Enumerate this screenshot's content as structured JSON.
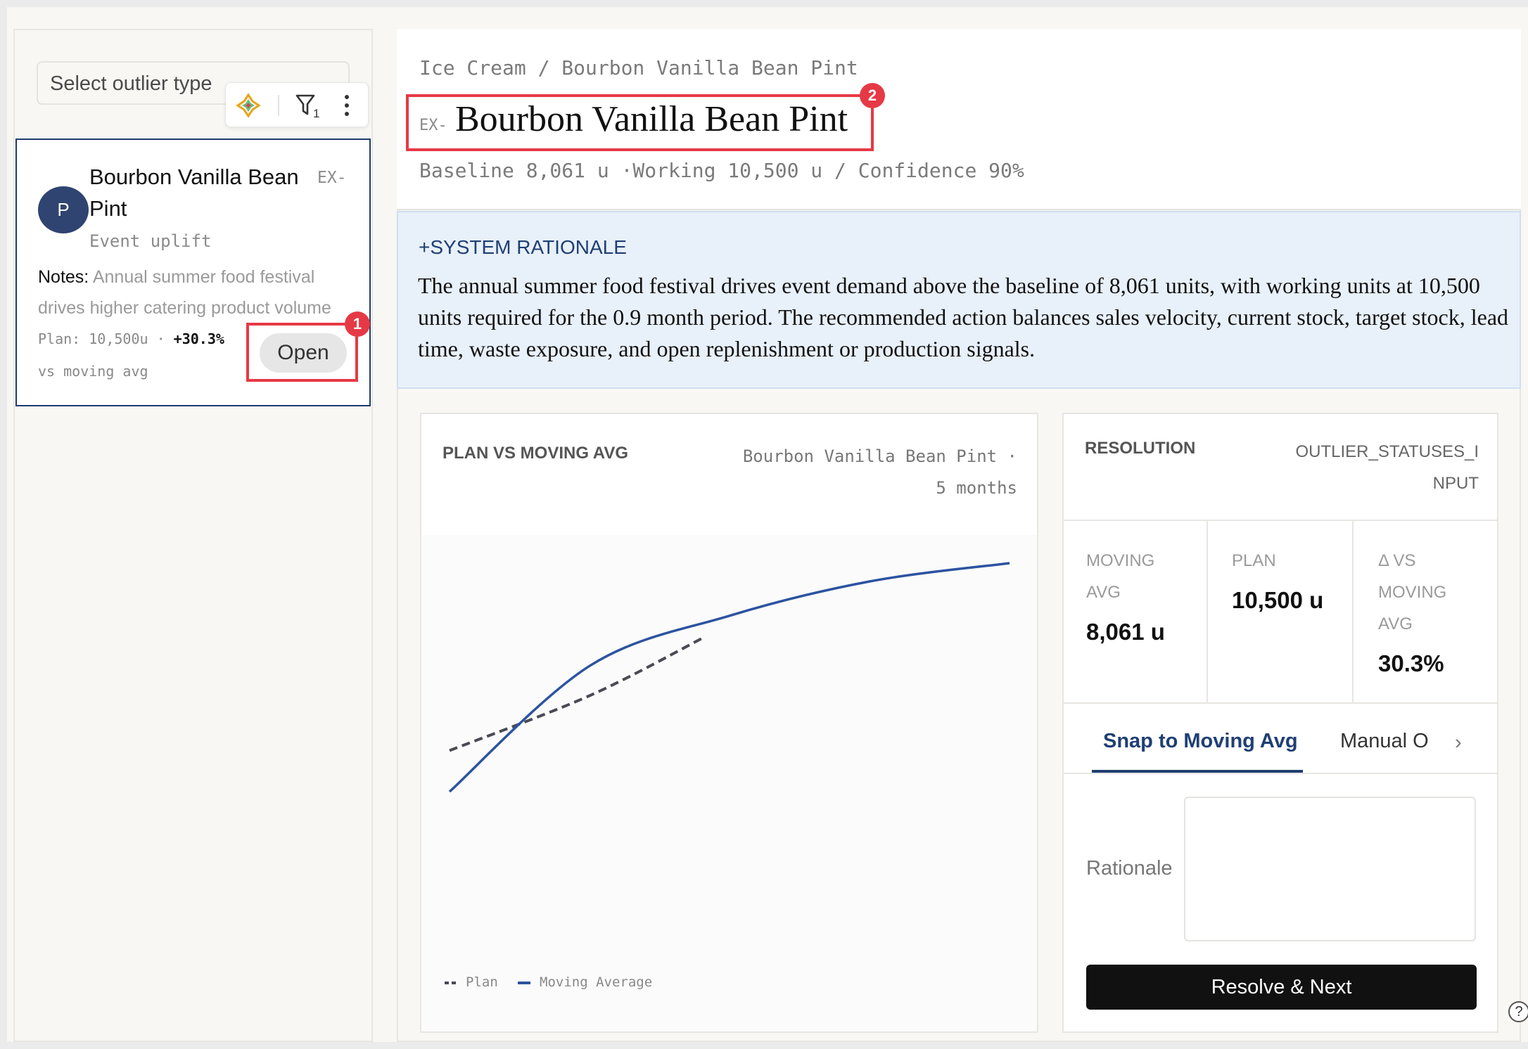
{
  "sidebar": {
    "select_placeholder": "Select outlier type",
    "filter_count": "1",
    "card": {
      "avatar": "P",
      "title": "Bourbon Vanilla Bean Pint",
      "id_prefix": "EX-",
      "subtitle": "Event uplift",
      "notes_label": "Notes:",
      "notes_text": "Annual summer food festival drives higher catering product volume",
      "plan_text": "Plan: 10,500u ·",
      "plan_delta": "+30.3%",
      "vs_text": "vs moving avg",
      "open_label": "Open"
    }
  },
  "annotations": {
    "badge_1": "1",
    "badge_2": "2"
  },
  "header": {
    "breadcrumb": "Ice Cream / Bourbon Vanilla Bean Pint",
    "id_prefix": "EX-",
    "title": "Bourbon Vanilla Bean Pint",
    "meta": "Baseline 8,061 u ·Working 10,500 u /  Confidence 90%"
  },
  "rationale": {
    "label": "+SYSTEM RATIONALE",
    "text": "The annual summer food festival drives event demand above the baseline of 8,061 units, with working units at 10,500 units required for the 0.9 month period. The recommended action balances sales velocity, current stock, target stock, lead time, waste exposure, and open replenishment or production signals."
  },
  "chart": {
    "title": "PLAN VS MOVING AVG",
    "subtitle_line1": "Bourbon Vanilla Bean Pint ·",
    "subtitle_line2": "5 months",
    "legend_plan": "Plan",
    "legend_moving": "Moving Average",
    "colors": {
      "plan": "#4a4a55",
      "moving": "#2c53a0"
    }
  },
  "chart_data": {
    "type": "line",
    "title": "PLAN VS MOVING AVG",
    "subtitle": "Bourbon Vanilla Bean Pint · 5 months",
    "series": [
      {
        "name": "Plan",
        "style": "dashed",
        "points": [
          [
            0,
            0.18
          ],
          [
            0.25,
            0.42
          ],
          [
            0.45,
            0.67
          ]
        ]
      },
      {
        "name": "Moving Average",
        "style": "solid",
        "points": [
          [
            0,
            0.0
          ],
          [
            0.25,
            0.55
          ],
          [
            0.5,
            0.77
          ],
          [
            0.75,
            0.92
          ],
          [
            1.0,
            1.0
          ]
        ]
      }
    ],
    "grid": false,
    "legend": "bottom-left"
  },
  "resolution": {
    "title": "RESOLUTION",
    "status_code": "OUTLIER_STATUSES_INPUT",
    "metrics": [
      {
        "label": "MOVING AVG",
        "value": "8,061 u"
      },
      {
        "label": "PLAN",
        "value": "10,500 u"
      },
      {
        "label": "Δ VS MOVING AVG",
        "value": "30.3%"
      }
    ],
    "tab_active": "Snap to Moving Avg",
    "tab_other": "Manual Override",
    "rationale_label": "Rationale",
    "resolve_label": "Resolve & Next",
    "help": "?"
  }
}
